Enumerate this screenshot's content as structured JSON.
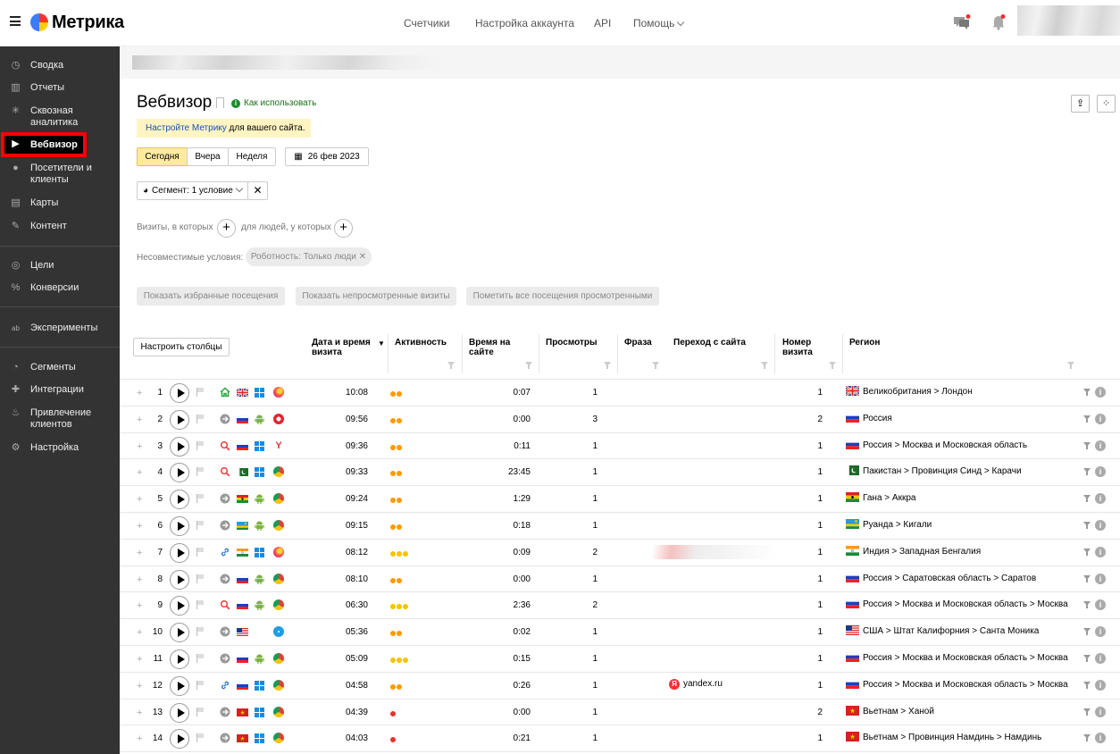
{
  "app": {
    "name": "Метрика"
  },
  "topnav": {
    "counters": "Счетчики",
    "account": "Настройка аккаунта",
    "api": "API",
    "help": "Помощь"
  },
  "sidebar": {
    "items": [
      {
        "label": "Сводка",
        "icon": "gauge-icon"
      },
      {
        "label": "Отчеты",
        "icon": "bar-chart-icon"
      },
      {
        "label": "Сквозная аналитика",
        "icon": "snowflake-icon"
      },
      {
        "label": "Вебвизор",
        "icon": "play-icon"
      },
      {
        "label": "Посетители и клиенты",
        "icon": "person-icon"
      },
      {
        "label": "Карты",
        "icon": "map-icon"
      },
      {
        "label": "Контент",
        "icon": "pencil-icon"
      },
      {
        "label": "Цели",
        "icon": "target-icon"
      },
      {
        "label": "Конверсии",
        "icon": "percent-icon"
      },
      {
        "label": "Эксперименты",
        "icon": "ab-icon"
      },
      {
        "label": "Сегменты",
        "icon": "pie-icon"
      },
      {
        "label": "Интеграции",
        "icon": "puzzle-icon"
      },
      {
        "label": "Привлечение клиентов",
        "icon": "fire-icon"
      },
      {
        "label": "Настройка",
        "icon": "gear-icon"
      }
    ]
  },
  "page": {
    "title": "Вебвизор",
    "how_to": "Как использовать",
    "notice_link": "Настройте Метрику",
    "notice_rest": " для вашего сайта.",
    "period": {
      "today": "Сегодня",
      "yesterday": "Вчера",
      "week": "Неделя",
      "date": "26 фев 2023"
    },
    "segment": "Сегмент: 1 условие",
    "visits_where": "Визиты, в которых",
    "people_where": "для людей, у которых",
    "incompatible_label": "Несовместимые условия:",
    "incompatible_value": "Роботность: Только люди",
    "actions": {
      "favorites": "Показать избранные посещения",
      "unviewed": "Показать непросмотренные визиты",
      "mark_viewed": "Пометить все посещения просмотренными"
    },
    "configure_columns": "Настроить столбцы"
  },
  "table": {
    "headers": {
      "datetime": "Дата и время визита",
      "activity": "Активность",
      "time_on_site": "Время на сайте",
      "views": "Просмотры",
      "phrase": "Фраза",
      "referrer": "Переход с сайта",
      "visit_number": "Номер визита",
      "region": "Регион"
    },
    "rows": [
      {
        "n": "1",
        "src": "home",
        "flag": "gb",
        "os": "windows",
        "browser": "firefox",
        "time": "10:08",
        "act": 2,
        "dur": "0:07",
        "views": "1",
        "ref": "",
        "vn": "1",
        "region": "Великобритания > Лондон"
      },
      {
        "n": "2",
        "src": "direct",
        "flag": "ru",
        "os": "android",
        "browser": "opera",
        "time": "09:56",
        "act": 2,
        "dur": "0:00",
        "views": "3",
        "ref": "",
        "vn": "2",
        "region": "Россия"
      },
      {
        "n": "3",
        "src": "search",
        "flag": "ru",
        "os": "windows",
        "browser": "yandex",
        "time": "09:36",
        "act": 2,
        "dur": "0:11",
        "views": "1",
        "ref": "",
        "vn": "1",
        "region": "Россия > Москва и Московская область"
      },
      {
        "n": "4",
        "src": "search",
        "flag": "pk",
        "os": "windows",
        "browser": "chrome",
        "time": "09:33",
        "act": 2,
        "dur": "23:45",
        "views": "1",
        "ref": "",
        "vn": "1",
        "region": "Пакистан > Провинция Синд > Карачи"
      },
      {
        "n": "5",
        "src": "direct",
        "flag": "gh",
        "os": "android",
        "browser": "chrome",
        "time": "09:24",
        "act": 2,
        "dur": "1:29",
        "views": "1",
        "ref": "",
        "vn": "1",
        "region": "Гана > Аккра"
      },
      {
        "n": "6",
        "src": "direct",
        "flag": "rw",
        "os": "android",
        "browser": "chrome",
        "time": "09:15",
        "act": 2,
        "dur": "0:18",
        "views": "1",
        "ref": "",
        "vn": "1",
        "region": "Руанда > Кигали"
      },
      {
        "n": "7",
        "src": "link",
        "flag": "in",
        "os": "windows",
        "browser": "firefox",
        "time": "08:12",
        "act": 3,
        "dur": "0:09",
        "views": "2",
        "ref": "",
        "vn": "1",
        "region": "Индия > Западная Бенгалия"
      },
      {
        "n": "8",
        "src": "direct",
        "flag": "ru",
        "os": "android",
        "browser": "chrome",
        "time": "08:10",
        "act": 2,
        "dur": "0:00",
        "views": "1",
        "ref": "",
        "vn": "1",
        "region": "Россия > Саратовская область > Саратов"
      },
      {
        "n": "9",
        "src": "search",
        "flag": "ru",
        "os": "android",
        "browser": "chrome",
        "time": "06:30",
        "act": 3,
        "dur": "2:36",
        "views": "2",
        "ref": "",
        "vn": "1",
        "region": "Россия > Москва и Московская область > Москва"
      },
      {
        "n": "10",
        "src": "direct",
        "flag": "us",
        "os": "apple",
        "browser": "safari",
        "time": "05:36",
        "act": 2,
        "dur": "0:02",
        "views": "1",
        "ref": "",
        "vn": "1",
        "region": "США > Штат Калифорния > Санта Моника"
      },
      {
        "n": "11",
        "src": "direct",
        "flag": "ru",
        "os": "android",
        "browser": "chrome",
        "time": "05:09",
        "act": 3,
        "dur": "0:15",
        "views": "1",
        "ref": "",
        "vn": "1",
        "region": "Россия > Москва и Московская область > Москва"
      },
      {
        "n": "12",
        "src": "link",
        "flag": "ru",
        "os": "windows",
        "browser": "chrome",
        "time": "04:58",
        "act": 2,
        "dur": "0:26",
        "views": "1",
        "ref": "yandex.ru",
        "vn": "1",
        "region": "Россия > Москва и Московская область > Москва"
      },
      {
        "n": "13",
        "src": "direct",
        "flag": "vn",
        "os": "windows",
        "browser": "chrome",
        "time": "04:39",
        "act": 1,
        "dur": "0:00",
        "views": "1",
        "ref": "",
        "vn": "2",
        "region": "Вьетнам > Ханой"
      },
      {
        "n": "14",
        "src": "direct",
        "flag": "vn",
        "os": "windows",
        "browser": "chrome",
        "time": "04:03",
        "act": 1,
        "dur": "0:21",
        "views": "1",
        "ref": "",
        "vn": "1",
        "region": "Вьетнам > Провинция Намдинь > Намдинь"
      }
    ]
  },
  "colors": {
    "activity_orange": "#ff9a00",
    "activity_yellow": "#f5c400",
    "activity_red": "#e8332a",
    "accent_yellow": "#ffeaa0"
  }
}
